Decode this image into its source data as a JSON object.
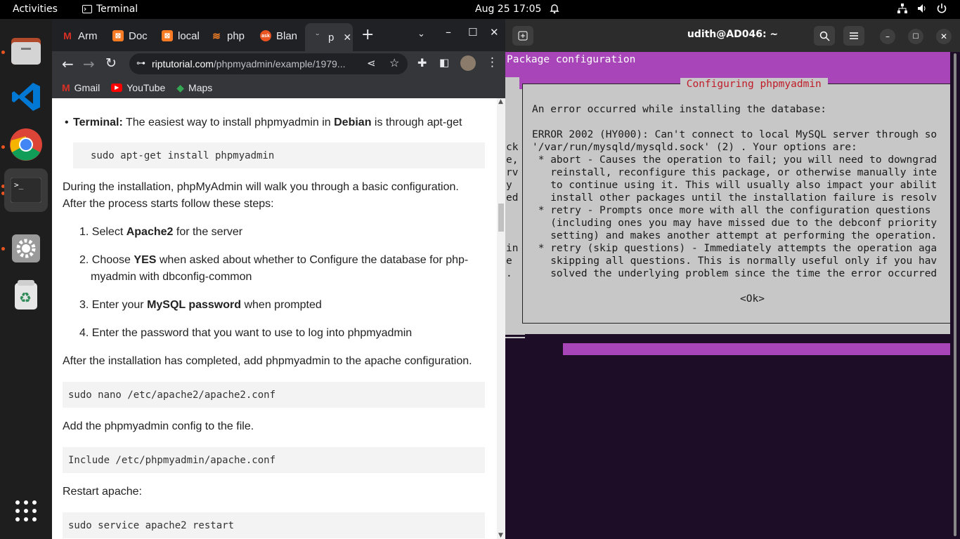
{
  "topbar": {
    "activities": "Activities",
    "app_name": "Terminal",
    "clock": "Aug 25  17:05"
  },
  "browser": {
    "tabs": [
      {
        "label": "Arm",
        "favicon": "gmail-icon",
        "color": "#d93025"
      },
      {
        "label": "Doc",
        "favicon": "xampp-icon",
        "color": "#fb7a24"
      },
      {
        "label": "local",
        "favicon": "xampp-icon",
        "color": "#fb7a24"
      },
      {
        "label": "php",
        "favicon": "stackoverflow-icon",
        "color": "#f48024"
      },
      {
        "label": "Blan",
        "favicon": "askubuntu-icon",
        "color": "#e95420"
      },
      {
        "label": "p",
        "favicon": "loading-icon",
        "color": "#aaaaaa"
      }
    ],
    "url_host": "riptutorial.com",
    "url_path": "/phpmyadmin/example/1979...",
    "bookmarks": [
      {
        "label": "Gmail",
        "icon": "gmail-icon"
      },
      {
        "label": "YouTube",
        "icon": "youtube-icon"
      },
      {
        "label": "Maps",
        "icon": "maps-icon"
      }
    ]
  },
  "page": {
    "terminal_label": "Terminal:",
    "terminal_text_1": " The easiest way to install phpmyadmin in ",
    "terminal_debian": "Debian",
    "terminal_text_2": " is through apt-get",
    "code1": "sudo apt-get install phpmyadmin",
    "para1_line1": "During the installation, phpMyAdmin will walk you through a basic configuration.",
    "para1_line2": "After the process starts follow these steps:",
    "step1_num": "1.",
    "step1_a": "Select ",
    "step1_b": "Apache2",
    "step1_c": " for the server",
    "step2_num": "2.",
    "step2_a": "Choose ",
    "step2_b": "YES",
    "step2_c": " when asked about whether to Configure the database for php-",
    "step2_d": "myadmin with dbconfig-common",
    "step3_num": "3.",
    "step3_a": "Enter your ",
    "step3_b": "MySQL password",
    "step3_c": " when prompted",
    "step4_num": "4.",
    "step4_a": "Enter the password that you want to use to log into phpmyadmin",
    "para2": "After the installation has completed, add phpmyadmin to the apache configuration.",
    "code2": "sudo nano /etc/apache2/apache2.conf",
    "para3": "Add the phpmyadmin config to the file.",
    "code3": "Include /etc/phpmyadmin/apache.conf",
    "para4": "Restart apache:",
    "code4": "sudo service apache2 restart"
  },
  "terminal": {
    "title": "udith@AD046: ~",
    "package_config": "Package configuration",
    "dialog_title": " Configuring phpmyadmin ",
    "lines": [
      "An error occurred while installing the database:",
      "",
      "ERROR 2002 (HY000): Can't connect to local MySQL server through so",
      "'/var/run/mysqld/mysqld.sock' (2) . Your options are:",
      " * abort - Causes the operation to fail; you will need to downgrad",
      "   reinstall, reconfigure this package, or otherwise manually inte",
      "   to continue using it. This will usually also impact your abilit",
      "   install other packages until the installation failure is resolv",
      " * retry - Prompts once more with all the configuration questions",
      "   (including ones you may have missed due to the debconf priority",
      "   setting) and makes another attempt at performing the operation.",
      " * retry (skip questions) - Immediately attempts the operation aga",
      "   skipping all questions. This is normally useful only if you hav",
      "   solved the underlying problem since the time the error occurred"
    ],
    "ok_button": "<Ok>",
    "left_fragments": [
      "ck",
      "e,",
      "rv",
      "y",
      "ed",
      "",
      "",
      "",
      "in",
      "e",
      "."
    ]
  }
}
